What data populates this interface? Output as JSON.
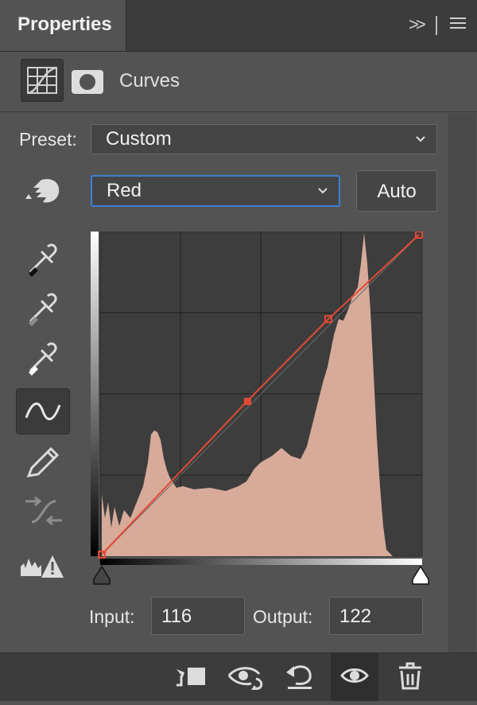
{
  "panel": {
    "tab_title": "Properties",
    "collapse_glyph": "»",
    "adjustment_title": "Curves"
  },
  "preset": {
    "label": "Preset:",
    "value": "Custom"
  },
  "channel": {
    "value": "Red"
  },
  "auto_label": "Auto",
  "inputs": {
    "input_label": "Input:",
    "input_value": "116",
    "output_label": "Output:",
    "output_value": "122"
  },
  "colors": {
    "histogram": "#d7aa9a",
    "curve": "#e24a33",
    "panel_bg": "#535353",
    "graph_bg": "#3d3d3d"
  },
  "icons": {
    "tools": [
      "on-image-adjust-icon",
      "black-point-eyedropper-icon",
      "gray-point-eyedropper-icon",
      "white-point-eyedropper-icon",
      "curve-points-icon",
      "pencil-icon",
      "smooth-curve-icon",
      "clipping-warning-icon"
    ],
    "footer": [
      "clip-to-layer-icon",
      "view-previous-state-icon",
      "reset-icon",
      "visibility-eye-icon",
      "delete-trash-icon"
    ]
  }
}
